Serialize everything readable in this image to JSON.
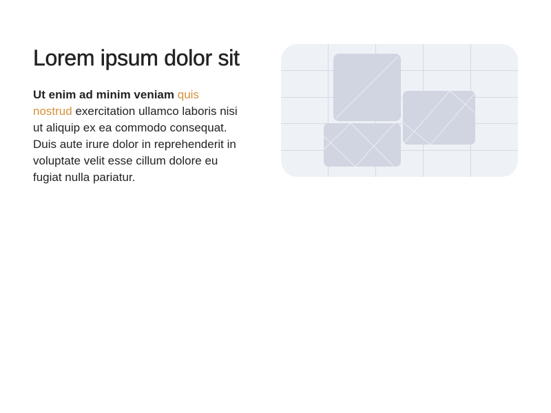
{
  "hero": {
    "title": "Lorem ipsum dolor sit",
    "lead": "Ut enim ad minim veniam",
    "link": "quis nostrud",
    "rest": "exercitation ullamco laboris nisi ut aliquip ex ea commodo consequat. Duis aute irure dolor in reprehenderit in voluptate velit esse cillum dolore eu fugiat nulla pariatur."
  },
  "illustration": {
    "icon": "image-placeholder-icon",
    "background_color": "#eef1f6",
    "tile_color": "#d0d5e1"
  },
  "colors": {
    "text": "#222222",
    "accent": "#d4923a"
  }
}
